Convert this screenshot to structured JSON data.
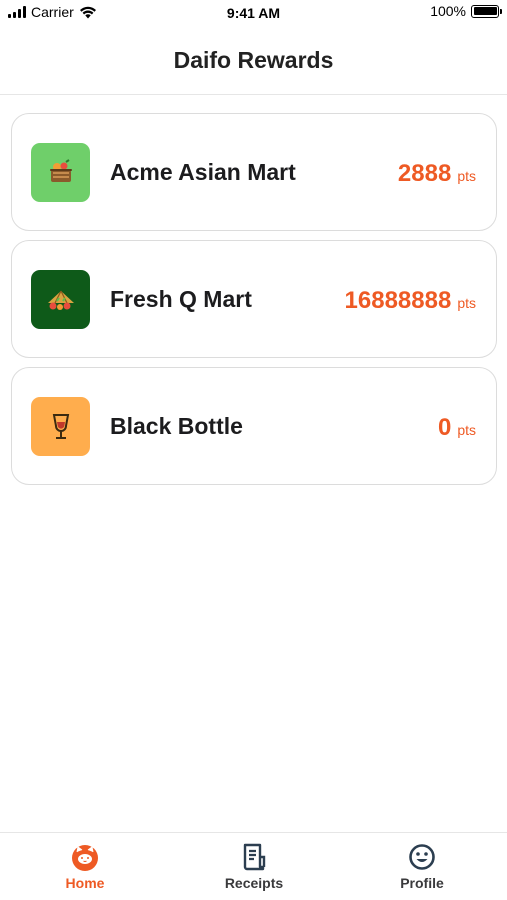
{
  "status_bar": {
    "carrier": "Carrier",
    "time": "9:41 AM",
    "battery": "100%"
  },
  "header": {
    "title": "Daifo Rewards"
  },
  "stores": [
    {
      "name": "Acme Asian Mart",
      "points": "2888",
      "unit": "pts",
      "icon": "grocery-basket-icon",
      "icon_bg": "#6fcf6a"
    },
    {
      "name": "Fresh Q Mart",
      "points": "16888888",
      "unit": "pts",
      "icon": "produce-icon",
      "icon_bg": "#0e5a19"
    },
    {
      "name": "Black Bottle",
      "points": "0",
      "unit": "pts",
      "icon": "wine-glass-icon",
      "icon_bg": "#ffad4d"
    }
  ],
  "tabs": [
    {
      "label": "Home",
      "icon": "cat-face-icon",
      "active": true
    },
    {
      "label": "Receipts",
      "icon": "receipt-icon",
      "active": false
    },
    {
      "label": "Profile",
      "icon": "smiley-icon",
      "active": false
    }
  ],
  "colors": {
    "accent": "#ee5a24"
  }
}
